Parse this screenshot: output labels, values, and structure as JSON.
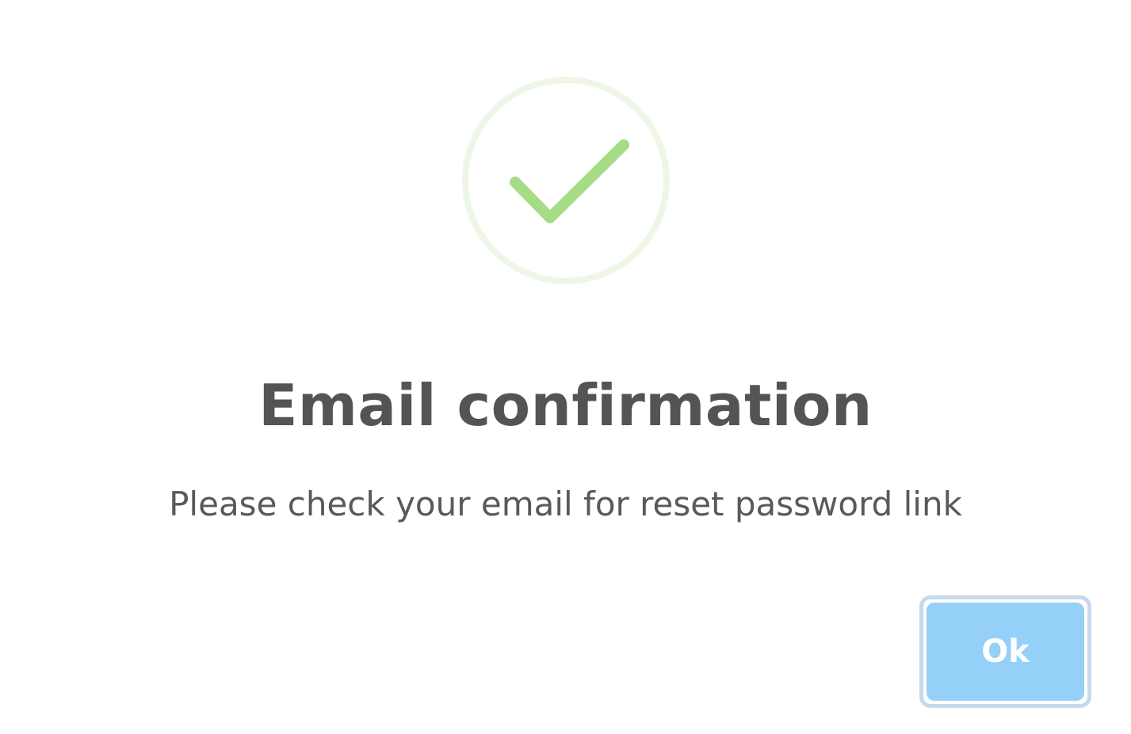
{
  "dialog": {
    "title": "Email confirmation",
    "message": "Please check your email for reset password link",
    "icon": "success-check-icon",
    "ok_label": "Ok"
  },
  "colors": {
    "success_ring": "#eef7e6",
    "success_check": "#a5dc86",
    "title_text": "#545454",
    "message_text": "#595959",
    "button_fill": "#95d0f8",
    "button_focus_ring": "#c6d9ec",
    "button_text": "#ffffff"
  }
}
